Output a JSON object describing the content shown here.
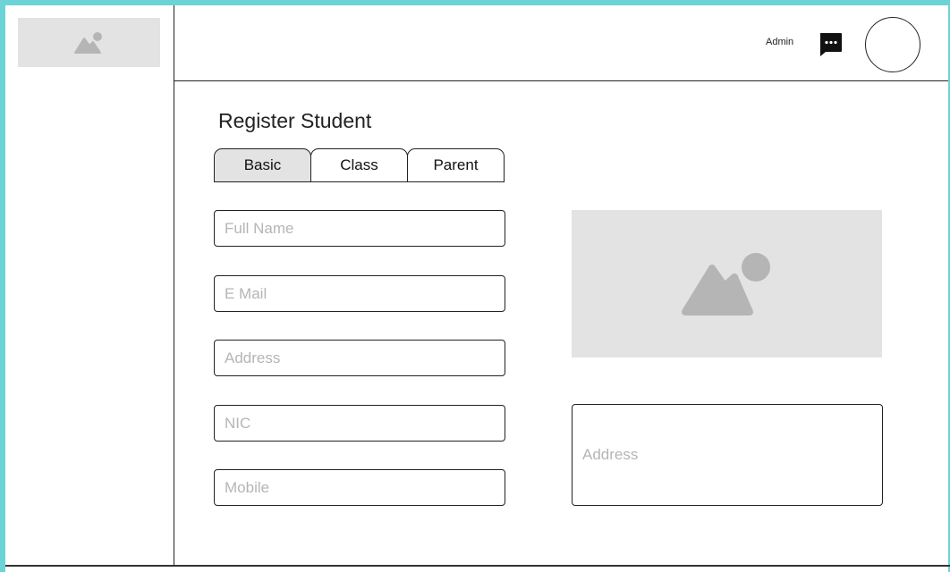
{
  "header": {
    "user_label": "Admin",
    "icons": {
      "chat": "chat-bubble-icon",
      "avatar": "user-avatar"
    }
  },
  "sidebar": {
    "logo_icon": "image-placeholder-icon"
  },
  "main": {
    "title": "Register Student",
    "tabs": [
      {
        "label": "Basic",
        "active": true
      },
      {
        "label": "Class",
        "active": false
      },
      {
        "label": "Parent",
        "active": false
      }
    ],
    "fields": {
      "full_name": {
        "placeholder": "Full Name",
        "value": ""
      },
      "email": {
        "placeholder": "E Mail",
        "value": ""
      },
      "address": {
        "placeholder": "Address",
        "value": ""
      },
      "nic": {
        "placeholder": "NIC",
        "value": ""
      },
      "mobile": {
        "placeholder": "Mobile",
        "value": ""
      },
      "address_notes": {
        "placeholder": "Address",
        "value": ""
      }
    },
    "photo_icon": "image-placeholder-icon"
  },
  "colors": {
    "frame_accent": "#6ed3d6",
    "placeholder_bg": "#e3e3e3",
    "placeholder_icon": "#b5b5b5",
    "active_tab_bg": "#e3e3e3"
  }
}
